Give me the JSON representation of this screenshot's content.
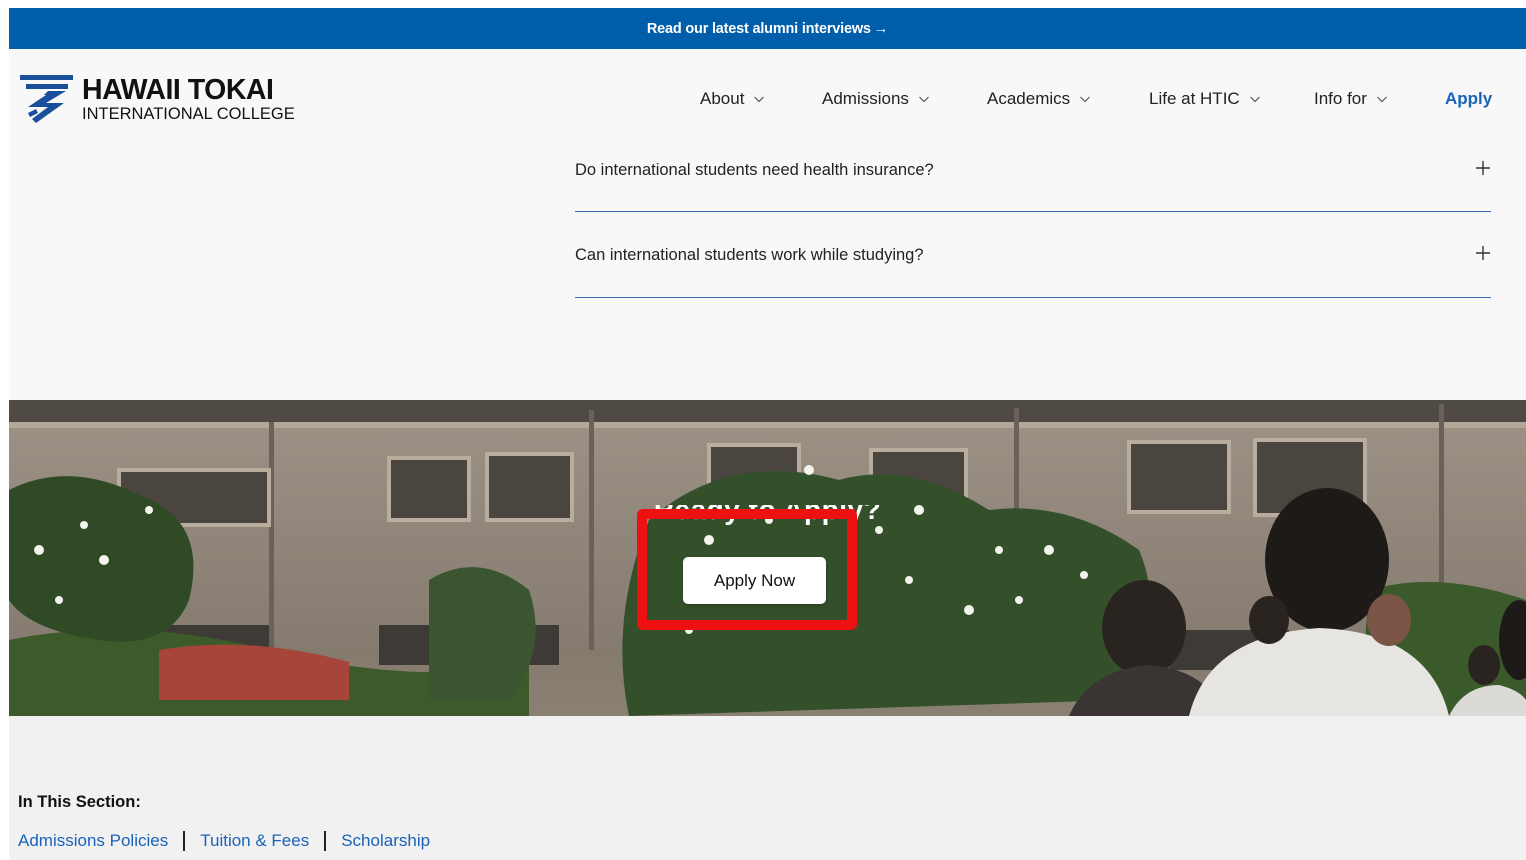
{
  "announcement": {
    "text": "Read our latest alumni interviews",
    "arrow": "→"
  },
  "logo": {
    "name_line1": "HAWAII TOKAI",
    "name_line2": "INTERNATIONAL COLLEGE"
  },
  "nav": {
    "items": [
      {
        "label": "About",
        "icon": "chevron-down-icon"
      },
      {
        "label": "Admissions",
        "icon": "chevron-down-icon"
      },
      {
        "label": "Academics",
        "icon": "chevron-down-icon"
      },
      {
        "label": "Life at HTIC",
        "icon": "chevron-down-icon"
      },
      {
        "label": "Info for",
        "icon": "chevron-down-icon"
      }
    ],
    "apply_label": "Apply"
  },
  "faq": {
    "items": [
      {
        "question": "Do international students need health insurance?",
        "icon": "plus-icon"
      },
      {
        "question": "Can international students work while studying?",
        "icon": "plus-icon"
      }
    ]
  },
  "hero": {
    "title": "Ready to Apply?",
    "button_label": "Apply Now"
  },
  "section": {
    "title": "In This Section:",
    "links": [
      "Admissions Policies",
      "Tuition & Fees",
      "Scholarship"
    ]
  },
  "colors": {
    "brand_blue": "#005eab",
    "link_blue": "#1a63b8",
    "highlight_red": "#ee1111"
  }
}
